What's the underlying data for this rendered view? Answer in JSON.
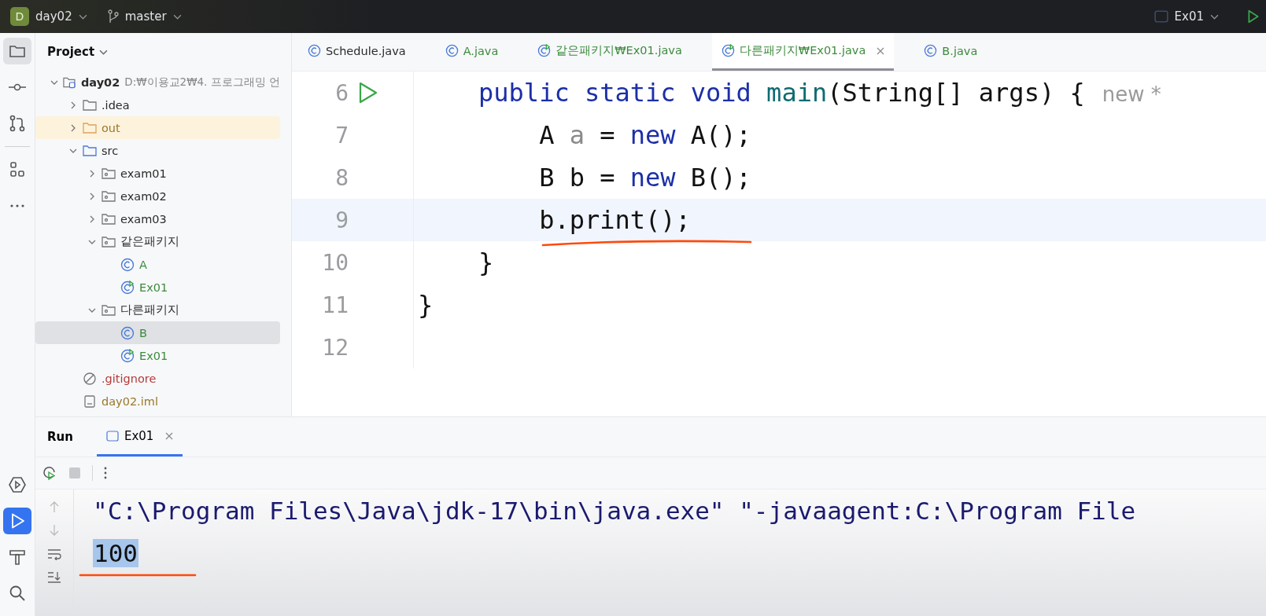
{
  "top_bar": {
    "project": {
      "badge": "D",
      "name": "day02"
    },
    "branch": "master",
    "run_config": "Ex01"
  },
  "left_toolbar": [
    {
      "selected": true
    },
    {
      "selected": false
    },
    {
      "selected": false
    },
    {
      "selected": false
    },
    {
      "selected": false
    }
  ],
  "bottom_toolbar": [
    {
      "selected": false
    },
    {
      "selected": true
    },
    {
      "selected": false
    },
    {
      "selected": false
    }
  ],
  "project_panel": {
    "title": "Project",
    "tree": [
      {
        "name": "day02",
        "path": "D:₩이용교2₩4. 프로그래밍 언",
        "kind": "module",
        "color": "#2b2b2b",
        "expanded": true,
        "selected": false,
        "children": [
          {
            "name": ".idea",
            "kind": "folder",
            "color": "#2b2b2b",
            "expanded": false,
            "selected": false
          },
          {
            "name": "out",
            "kind": "folder",
            "color": "#9a7a2a",
            "excluded": true,
            "expanded": false,
            "selected": false
          },
          {
            "name": "src",
            "kind": "source",
            "color": "#2b2b2b",
            "expanded": true,
            "selected": false,
            "children": [
              {
                "name": "exam01",
                "kind": "package",
                "color": "#2b2b2b",
                "expanded": false,
                "selected": false
              },
              {
                "name": "exam02",
                "kind": "package",
                "color": "#2b2b2b",
                "expanded": false,
                "selected": false
              },
              {
                "name": "exam03",
                "kind": "package",
                "color": "#2b2b2b",
                "expanded": false,
                "selected": false
              },
              {
                "name": "같은패키지",
                "kind": "package",
                "color": "#2b2b2b",
                "expanded": true,
                "selected": false,
                "children": [
                  {
                    "name": "A",
                    "kind": "class",
                    "color": "#3d8b3d",
                    "selected": false
                  },
                  {
                    "name": "Ex01",
                    "kind": "main-class",
                    "color": "#3d8b3d",
                    "selected": false
                  }
                ]
              },
              {
                "name": "다른패키지",
                "kind": "package",
                "color": "#2b2b2b",
                "expanded": true,
                "selected": false,
                "children": [
                  {
                    "name": "B",
                    "kind": "class",
                    "color": "#3d8b3d",
                    "selected": true
                  },
                  {
                    "name": "Ex01",
                    "kind": "main-class",
                    "color": "#3d8b3d",
                    "selected": false
                  }
                ]
              }
            ]
          },
          {
            "name": ".gitignore",
            "kind": "ignore",
            "color": "#b53a3a",
            "selected": false
          },
          {
            "name": "day02.iml",
            "kind": "file",
            "color": "#9a7a2a",
            "selected": false
          }
        ]
      }
    ]
  },
  "editor_tabs": [
    {
      "label": "Schedule.java",
      "kind": "class",
      "color": "#2b2b2b",
      "selected": false
    },
    {
      "label": "A.java",
      "kind": "class",
      "color": "#3d8b3d",
      "selected": false
    },
    {
      "label": "같은패키지₩Ex01.java",
      "kind": "main-class",
      "color": "#3d8b3d",
      "selected": false
    },
    {
      "label": "다른패키지₩Ex01.java",
      "kind": "main-class",
      "color": "#3d8b3d",
      "selected": true
    },
    {
      "label": "B.java",
      "kind": "class",
      "color": "#3d8b3d",
      "selected": false
    }
  ],
  "editor": {
    "lines": [
      {
        "number": "6",
        "run": true,
        "current": false,
        "tokens": [
          {
            "t": "    public",
            "kind": "kw"
          },
          {
            "t": " static",
            "kind": "kw"
          },
          {
            "t": " void",
            "kind": "kw"
          },
          {
            "t": " main",
            "kind": "fn"
          },
          {
            "t": "(String[] args) {"
          },
          {
            "t": "new *",
            "kind": "hint"
          }
        ]
      },
      {
        "number": "7",
        "run": false,
        "current": false,
        "tokens": [
          {
            "t": "        A "
          },
          {
            "t": "a",
            "kind": "unused"
          },
          {
            "t": " = "
          },
          {
            "t": "new",
            "kind": "kw"
          },
          {
            "t": " A();"
          }
        ]
      },
      {
        "number": "8",
        "run": false,
        "current": false,
        "tokens": [
          {
            "t": "        B b = "
          },
          {
            "t": "new",
            "kind": "kw"
          },
          {
            "t": " B();"
          }
        ]
      },
      {
        "number": "9",
        "run": false,
        "current": true,
        "tokens": [
          {
            "t": "        b.print();"
          }
        ]
      },
      {
        "number": "10",
        "run": false,
        "current": false,
        "tokens": [
          {
            "t": "    }"
          }
        ]
      },
      {
        "number": "11",
        "run": false,
        "current": false,
        "tokens": [
          {
            "t": "}"
          }
        ]
      },
      {
        "number": "12",
        "run": false,
        "current": false
      }
    ]
  },
  "run_panel": {
    "title": "Run",
    "tabs": [
      {
        "label": "Ex01",
        "selected": true
      }
    ],
    "console": [
      {
        "text": "\"C:\\Program Files\\Java\\jdk-17\\bin\\java.exe\" \"-javaagent:C:\\Program File",
        "kind": "command"
      },
      {
        "text": "100",
        "kind": "selected-output"
      }
    ]
  }
}
